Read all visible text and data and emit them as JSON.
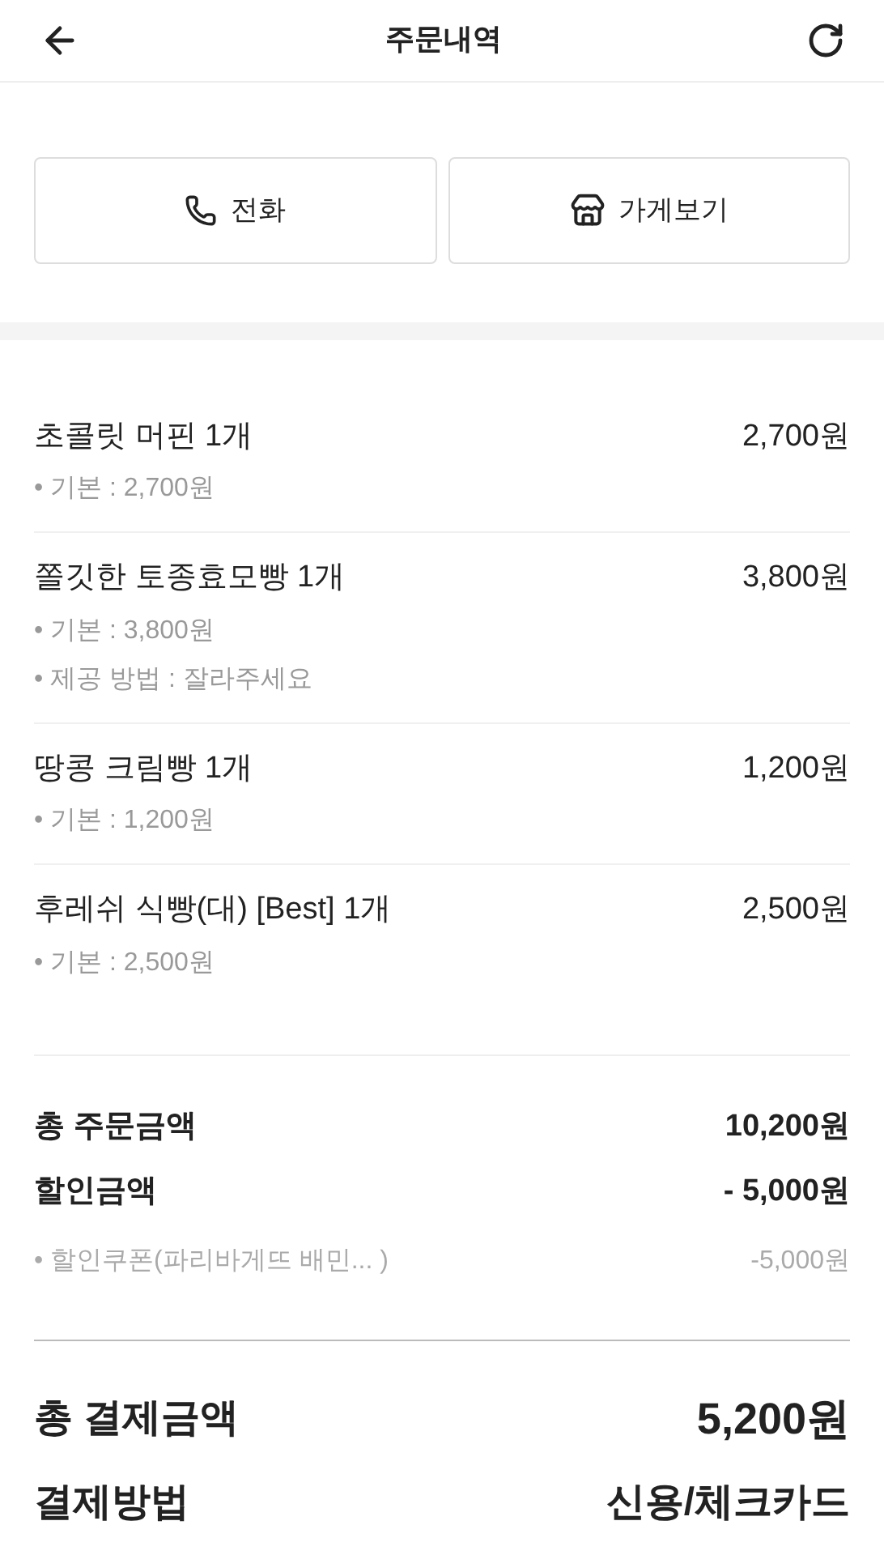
{
  "header": {
    "title": "주문내역"
  },
  "actions": [
    {
      "kind": "phone",
      "label": "전화"
    },
    {
      "kind": "store",
      "label": "가게보기"
    }
  ],
  "items": [
    {
      "name": "초콜릿 머핀 1개",
      "price": "2,700원",
      "options": [
        "• 기본 : 2,700원"
      ]
    },
    {
      "name": "쫄깃한 토종효모빵 1개",
      "price": "3,800원",
      "options": [
        "• 기본 : 3,800원",
        "• 제공 방법 : 잘라주세요"
      ]
    },
    {
      "name": "땅콩 크림빵 1개",
      "price": "1,200원",
      "options": [
        "• 기본 : 1,200원"
      ]
    },
    {
      "name": "후레쉬 식빵(대) [Best] 1개",
      "price": "2,500원",
      "options": [
        "• 기본 : 2,500원"
      ]
    }
  ],
  "summary": [
    {
      "kind": "main",
      "label": "총 주문금액",
      "value": "10,200원"
    },
    {
      "kind": "main",
      "label": "할인금액",
      "value": "- 5,000원"
    },
    {
      "kind": "sub",
      "label": "• 할인쿠폰(파리바게뜨 배민... )",
      "value": "-5,000원"
    }
  ],
  "payment": [
    {
      "label": "총 결제금액",
      "value": "5,200원"
    },
    {
      "label": "결제방법",
      "value": "신용/체크카드"
    }
  ]
}
